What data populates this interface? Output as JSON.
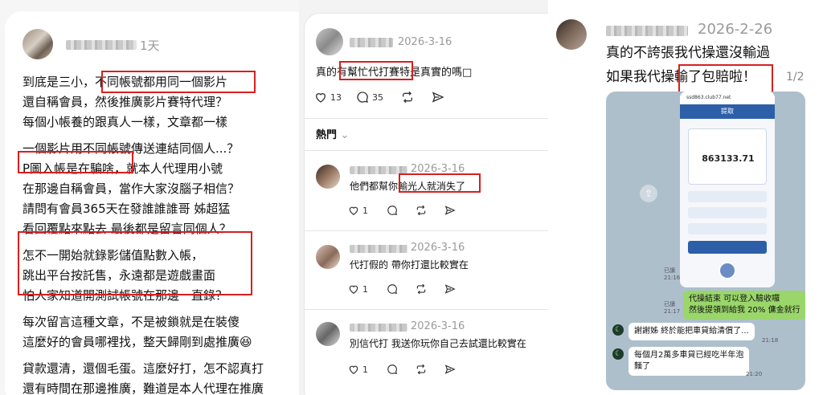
{
  "panel1": {
    "time": "1天",
    "lines": [
      "到底是三小，不同帳號都用同一個影片",
      "還自稱會員，然後推廣影片賽特代理？",
      "每個小帳養的跟真人一樣，文章都一樣",
      "",
      "一個影片用不同帳號傳送連結同個人...？",
      "P圖入帳是在騙啥，就本人代理用小號",
      "在那邊自稱會員，當作大家沒腦子相信？",
      "請問有會員365天在發誰誰誰哥 姊超猛",
      "看回覆點來點去 最後都是留言同個人？",
      "",
      "怎不一開始就錄影儲值點數入帳，",
      "跳出平台按託售，永遠都是遊戲畫面",
      "怕人家知道開測試帳號在那邊一直錄？",
      "",
      "每次留言這種文章，不是被鎖就是在裝傻",
      "這麼好的會員哪裡找，整天歸剛到處推廣😆",
      "",
      "貸款還清，還個毛蛋。這麼好打，怎不認真打",
      "還有時間在那邊推廣，難道是本人代理在推廣"
    ]
  },
  "panel2": {
    "post": {
      "date": "2026-3-16",
      "text": "真的有幫忙代打賽特是真實的嗎□",
      "likes": "13",
      "comments": "35"
    },
    "sort_label": "熱門",
    "replies": [
      {
        "date": "2026-3-16",
        "text": "他們都幫你輸光人就消失了",
        "likes": "1"
      },
      {
        "date": "2026-3-16",
        "text": "代打假的 帶你打還比較實在",
        "likes": "1"
      },
      {
        "date": "2026-3-16",
        "text": "別信代打 我送你玩你自己去試還比較實在",
        "likes": "1"
      }
    ]
  },
  "panel3": {
    "date": "2026-2-26",
    "line1": "真的不誇張我代操還沒輸過",
    "line2": "如果我代操輸了包賠啦！",
    "page": "1/2",
    "phone": {
      "url": "ssd863.club77.net",
      "title": "提取",
      "balance": "863133.71"
    },
    "messages": [
      {
        "side": "right",
        "text": "代操結束 可以登入驗收囉\n然後提領到給我 20% 傭金就行",
        "time": "21:17"
      },
      {
        "side": "left",
        "text": "謝謝姊 終於能把車貸給清償了...",
        "time": "21:18"
      },
      {
        "side": "left",
        "text": "每個月2萬多車貸已經吃半年泡\n麵了",
        "time": "21:20"
      }
    ],
    "read_labels": [
      "已讀\n21:16",
      "已讀\n21:17"
    ]
  },
  "colors": {
    "highlight": "#d81f1f",
    "line_green": "#9ad66a",
    "chat_bg": "#aebfcc"
  }
}
